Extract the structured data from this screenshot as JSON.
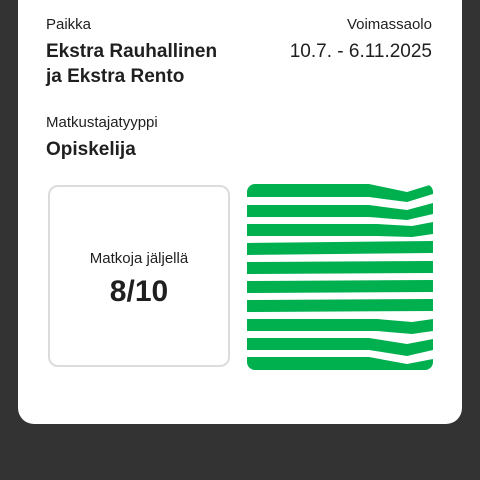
{
  "ticket": {
    "zone_label": "Paikka",
    "zone_value_line1": "Ekstra Rauhallinen",
    "zone_value_line2": "ja Ekstra Rento",
    "validity_label": "Voimassaolo",
    "validity_value": "10.7. - 6.11.2025",
    "passenger_label": "Matkustajatyyppi",
    "passenger_value": "Opiskelija",
    "trips_label": "Matkoja jäljellä",
    "trips_value": "8/10"
  },
  "colors": {
    "accent_green": "#00b04f",
    "background": "#333333",
    "card": "#ffffff"
  },
  "icons": {
    "validity_animation": "green-stripes-animation"
  }
}
